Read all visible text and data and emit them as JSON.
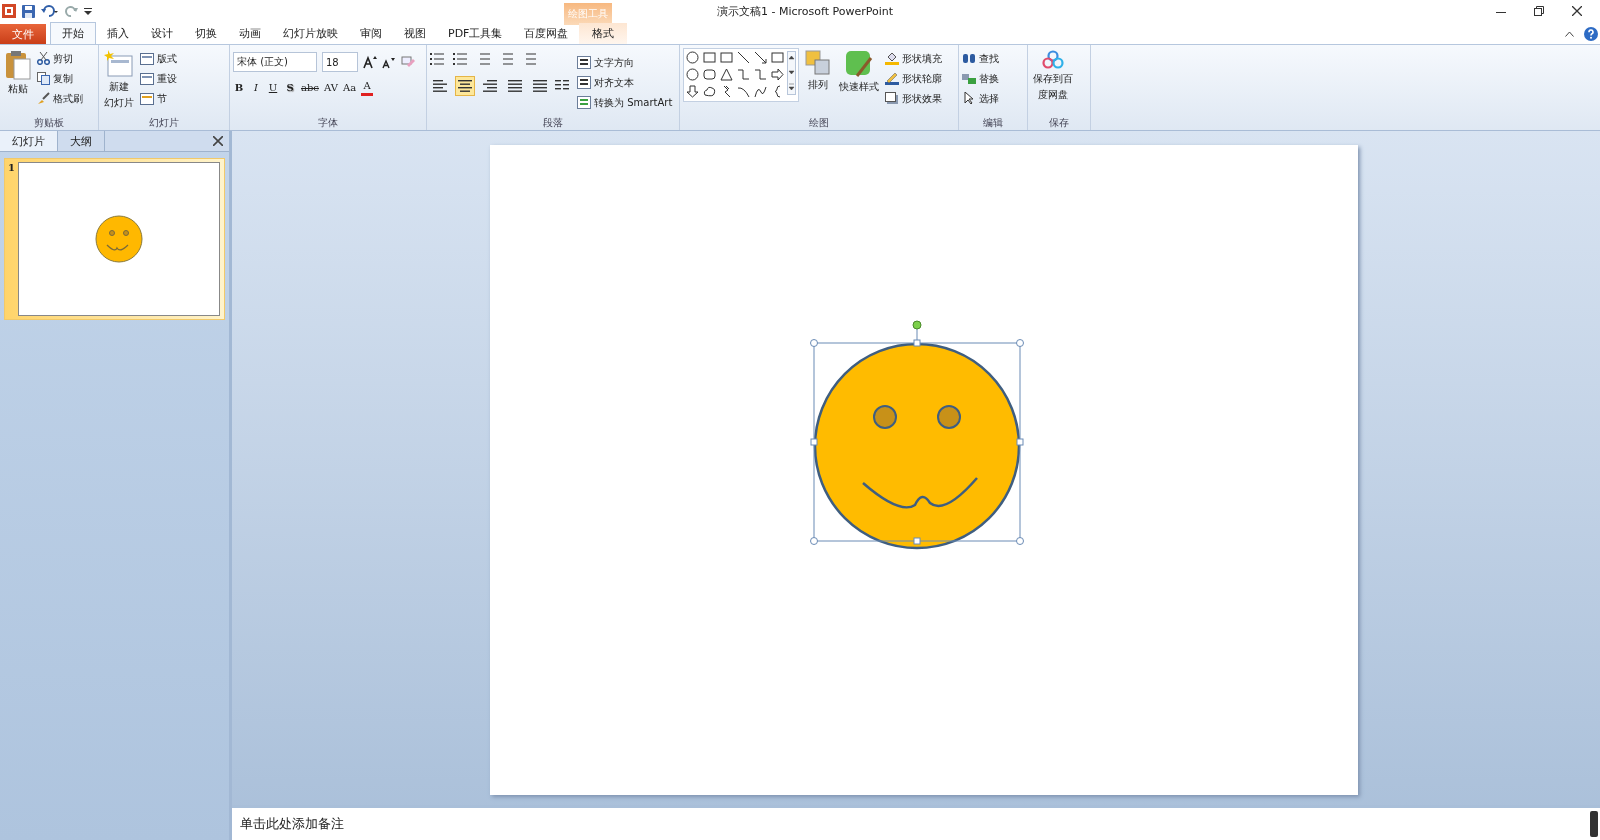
{
  "window": {
    "title": "演示文稿1 - Microsoft PowerPoint",
    "contextual_label": "绘图工具"
  },
  "file_tab": "文件",
  "tabs": [
    {
      "label": "开始",
      "selected": true
    },
    {
      "label": "插入",
      "selected": false
    },
    {
      "label": "设计",
      "selected": false
    },
    {
      "label": "切换",
      "selected": false
    },
    {
      "label": "动画",
      "selected": false
    },
    {
      "label": "幻灯片放映",
      "selected": false
    },
    {
      "label": "审阅",
      "selected": false
    },
    {
      "label": "视图",
      "selected": false
    },
    {
      "label": "PDF工具集",
      "selected": false
    },
    {
      "label": "百度网盘",
      "selected": false
    },
    {
      "label": "格式",
      "selected": false,
      "contextual": true
    }
  ],
  "ribbon": {
    "clipboard": {
      "label": "剪贴板",
      "big": "粘贴",
      "small": [
        "剪切",
        "复制",
        "格式刷"
      ]
    },
    "slides": {
      "label": "幻灯片",
      "big": [
        "新建",
        "幻灯片"
      ],
      "small": [
        "版式",
        "重设",
        "节"
      ]
    },
    "font": {
      "label": "字体",
      "font_name": "宋体 (正文)",
      "font_size": "18",
      "buttons": [
        "B",
        "I",
        "U",
        "S",
        "abc",
        "AV",
        "Aa",
        "A"
      ]
    },
    "paragraph": {
      "label": "段落",
      "align": [
        {
          "selected": false
        },
        {
          "selected": true
        },
        {
          "selected": false
        },
        {
          "selected": false
        },
        {
          "selected": false
        }
      ],
      "small": [
        "文字方向",
        "对齐文本",
        "转换为 SmartArt"
      ]
    },
    "drawing": {
      "label": "绘图",
      "arrange": "排列",
      "quick_styles": "快速样式",
      "small": [
        "形状填充",
        "形状轮廓",
        "形状效果"
      ]
    },
    "editing": {
      "label": "编辑",
      "small": [
        "查找",
        "替换",
        "选择"
      ]
    },
    "save": {
      "label": "保存",
      "big": [
        "保存到百",
        "度网盘"
      ]
    }
  },
  "pane": {
    "tabs": [
      {
        "label": "幻灯片",
        "selected": true
      },
      {
        "label": "大纲",
        "selected": false
      }
    ],
    "slides": [
      {
        "number": "1",
        "selected": true
      }
    ]
  },
  "slide": {
    "shape_selected": true
  },
  "notes": {
    "placeholder": "单击此处添加备注"
  }
}
